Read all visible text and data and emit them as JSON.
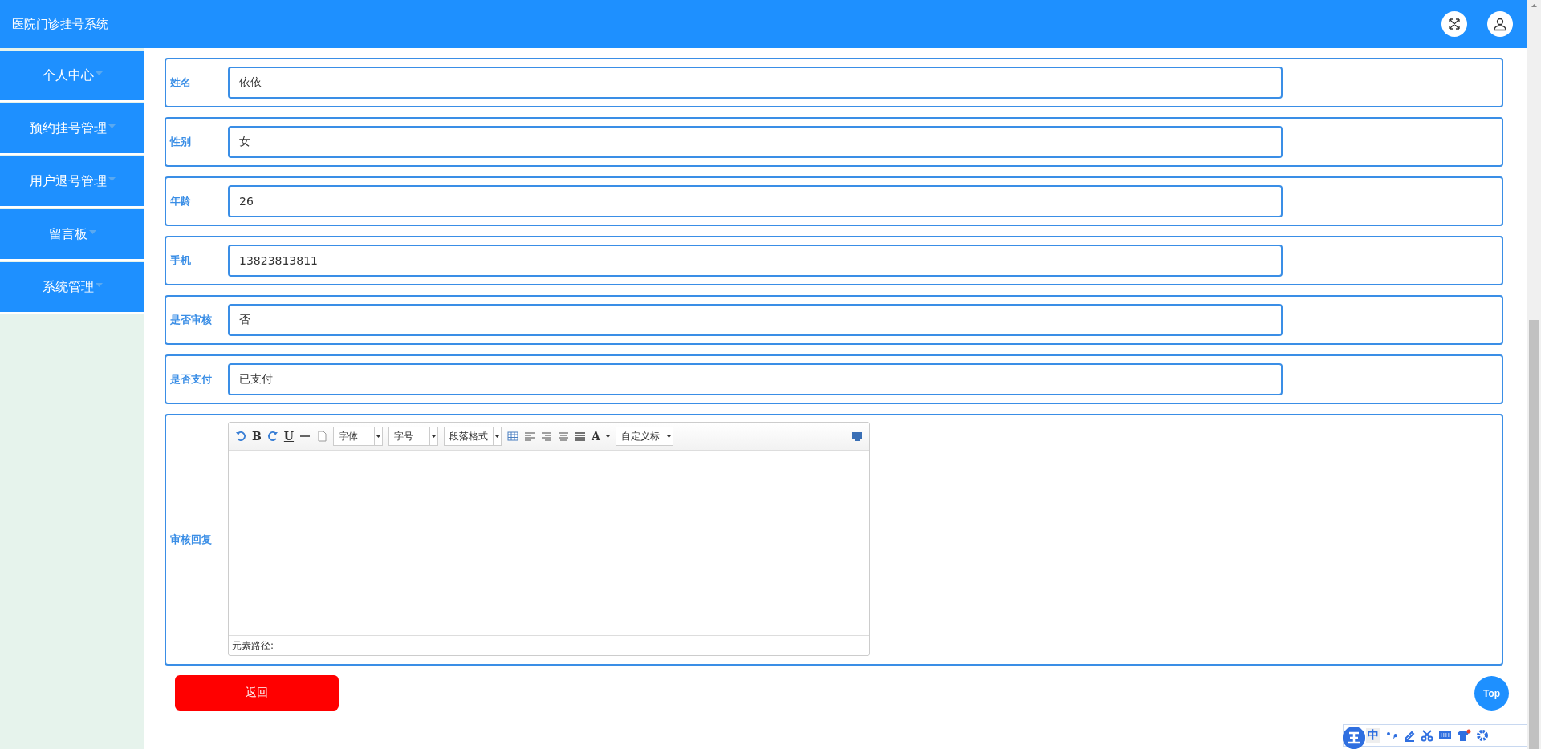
{
  "header": {
    "title": "医院门诊挂号系统"
  },
  "sidebar": {
    "items": [
      {
        "label": "个人中心"
      },
      {
        "label": "预约挂号管理"
      },
      {
        "label": "用户退号管理"
      },
      {
        "label": "留言板"
      },
      {
        "label": "系统管理"
      }
    ]
  },
  "form": {
    "fields": [
      {
        "label": "姓名",
        "value": "依依"
      },
      {
        "label": "性别",
        "value": "女"
      },
      {
        "label": "年龄",
        "value": "26"
      },
      {
        "label": "手机",
        "value": "13823813811"
      },
      {
        "label": "是否审核",
        "value": "否"
      },
      {
        "label": "是否支付",
        "value": "已支付"
      }
    ],
    "editor": {
      "label": "审核回复",
      "bold": "B",
      "underline": "U",
      "font_color": "A",
      "selects": [
        "字体",
        "字号",
        "段落格式",
        "自定义标"
      ],
      "path_label": "元素路径:"
    },
    "back_button": "返回"
  },
  "top_button": "Top",
  "ime_bar": {
    "mode": "中"
  }
}
